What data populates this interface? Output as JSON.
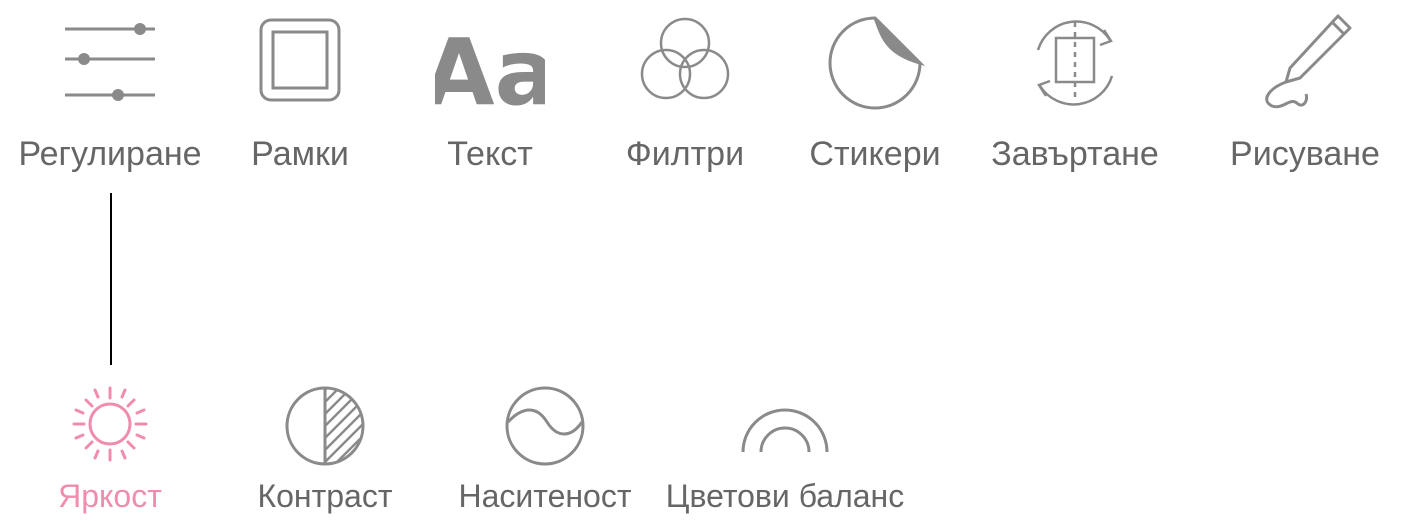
{
  "colors": {
    "icon": "#8a8a8a",
    "text": "#666666",
    "active": "#f08cac",
    "connector": "#000000"
  },
  "toolbar": {
    "items": [
      {
        "label": "Регулиране",
        "icon": "sliders-icon"
      },
      {
        "label": "Рамки",
        "icon": "frame-icon"
      },
      {
        "label": "Текст",
        "icon": "text-icon",
        "glyph": "Aa"
      },
      {
        "label": "Филтри",
        "icon": "filter-circles-icon"
      },
      {
        "label": "Стикери",
        "icon": "sticker-icon"
      },
      {
        "label": "Завъртане",
        "icon": "rotate-icon"
      },
      {
        "label": "Рисуване",
        "icon": "pen-icon"
      }
    ]
  },
  "adjust": {
    "items": [
      {
        "label": "Яркост",
        "icon": "brightness-sun-icon",
        "selected": true
      },
      {
        "label": "Контраст",
        "icon": "contrast-icon",
        "selected": false
      },
      {
        "label": "Наситеност",
        "icon": "saturation-icon",
        "selected": false
      },
      {
        "label": "Цветови баланс",
        "icon": "color-balance-icon",
        "selected": false
      }
    ]
  }
}
